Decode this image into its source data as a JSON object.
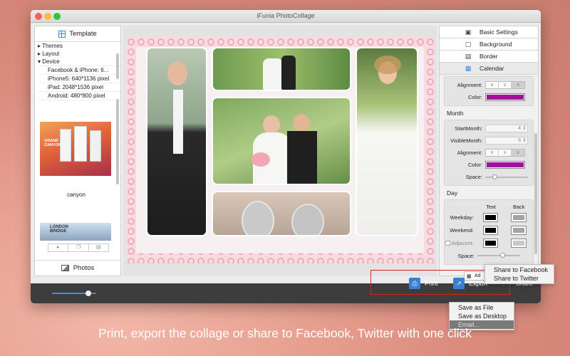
{
  "window": {
    "title": "iFunia PhotoCollage"
  },
  "left_panel": {
    "template_label": "Template",
    "tree": {
      "themes": "Themes",
      "layout": "Layout",
      "device": "Device",
      "devices": [
        "Facebook & iPhone: 6...",
        "iPhone5: 640*1136 pixel",
        "iPad: 2048*1536 pixel",
        "Android: 480*800 pixel"
      ]
    },
    "thumbnails": [
      {
        "label": "canyon",
        "text": "GRAND CANYON"
      },
      {
        "label": "",
        "text": "LONDON BRIDGE"
      }
    ],
    "photos_label": "Photos"
  },
  "right_panel": {
    "tabs": [
      {
        "label": "Basic Settings",
        "icon": "briefcase-icon"
      },
      {
        "label": "Background",
        "icon": "page-icon"
      },
      {
        "label": "Border",
        "icon": "border-icon"
      },
      {
        "label": "Calendar",
        "icon": "calendar-icon"
      }
    ],
    "top_group": {
      "alignment_label": "Alignment:",
      "color_label": "Color:",
      "color": "#a0119e"
    },
    "month": {
      "title": "Month",
      "start_month_label": "StartMonth:",
      "start_month": "4",
      "visible_month_label": "VisibleMonth:",
      "visible_month": "6",
      "alignment_label": "Alignment:",
      "color_label": "Color:",
      "color": "#a0119e",
      "space_label": "Space:"
    },
    "day": {
      "title": "Day",
      "text_col": "Text",
      "back_col": "Back",
      "weekday_label": "Weekday:",
      "weekend_label": "Weekend:",
      "adjacent_label": "Adjacent:",
      "space_label": "Space:",
      "weekday_text_color": "#000000",
      "weekday_back_color": "#a3a3a3",
      "weekend_text_color": "#000000",
      "weekend_back_color": "#a3a3a3",
      "adjacent_text_color": "#000000",
      "adjacent_back_color": "#c8c8c8"
    },
    "add_label": "Ad"
  },
  "bottom_bar": {
    "zoom_value": 0.82,
    "print_label": "Print",
    "export_label": "Export",
    "share_label": "Share"
  },
  "export_menu": {
    "items": [
      "Save as File",
      "Save as Desktop",
      "Email..."
    ]
  },
  "share_menu": {
    "items": [
      "Share to Facebook",
      "Share to Twitter"
    ]
  },
  "caption": "Print, export the collage or share to Facebook, Twitter with one click"
}
